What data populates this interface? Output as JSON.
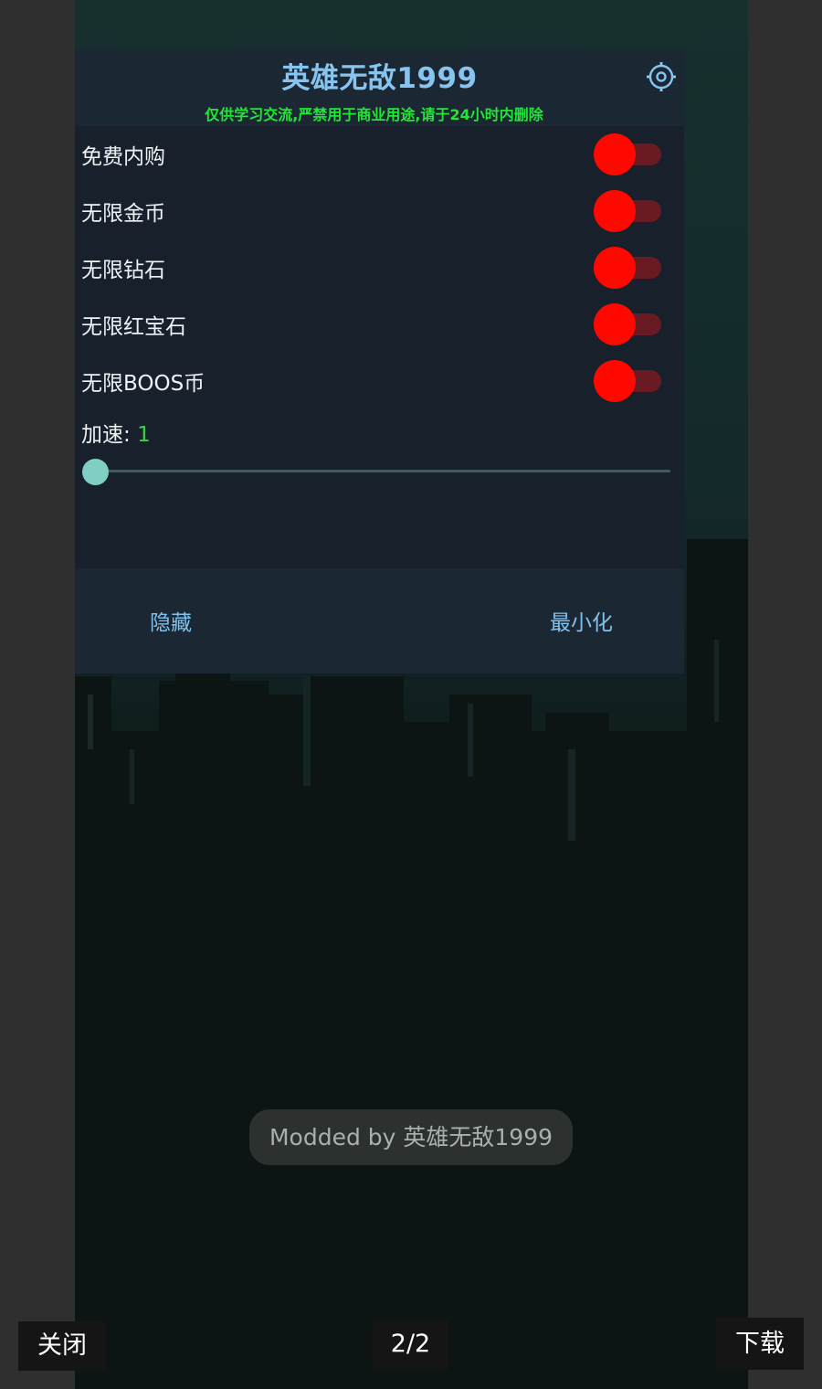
{
  "menu": {
    "title": "英雄无敌1999",
    "subtitle": "仅供学习交流,严禁用于商业用途,请于24小时内删除",
    "settings_icon": "gear-icon",
    "options": [
      {
        "label": "免费内购",
        "enabled": true
      },
      {
        "label": "无限金币",
        "enabled": true
      },
      {
        "label": "无限钻石",
        "enabled": true
      },
      {
        "label": "无限红宝石",
        "enabled": true
      },
      {
        "label": "无限BOOS币",
        "enabled": true
      }
    ],
    "speed": {
      "label": "加速: ",
      "value": "1",
      "min_fraction": 0
    },
    "footer": {
      "hide_label": "隐藏",
      "minimize_label": "最小化"
    }
  },
  "toast": {
    "text": "Modded by 英雄无敌1999"
  },
  "viewer": {
    "close_label": "关闭",
    "counter": "2/2",
    "download_label": "下载"
  },
  "colors": {
    "title": "#86c5f0",
    "subtitle": "#22e636",
    "toggle_on": "#ff0800",
    "slider_thumb": "#7fcfc4"
  }
}
